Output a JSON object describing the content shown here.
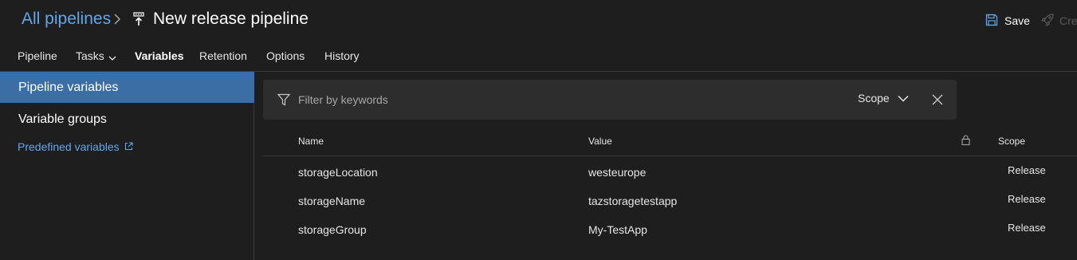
{
  "header": {
    "breadcrumb_root": "All pipelines",
    "title": "New release pipeline",
    "save_label": "Save",
    "create_label": "Cre"
  },
  "tabs": [
    {
      "label": "Pipeline"
    },
    {
      "label": "Tasks"
    },
    {
      "label": "Variables",
      "active": true
    },
    {
      "label": "Retention"
    },
    {
      "label": "Options"
    },
    {
      "label": "History"
    }
  ],
  "sidebar": {
    "items": [
      {
        "label": "Pipeline variables",
        "selected": true
      },
      {
        "label": "Variable groups"
      }
    ],
    "predefined_link": "Predefined variables"
  },
  "filter": {
    "placeholder": "Filter by keywords",
    "value": "",
    "scope_label": "Scope"
  },
  "table": {
    "columns": [
      "Name",
      "Value",
      "Scope"
    ],
    "rows": [
      {
        "name": "storageLocation",
        "value": "westeurope",
        "scope": "Release"
      },
      {
        "name": "storageName",
        "value": "tazstoragetestapp",
        "scope": "Release"
      },
      {
        "name": "storageGroup",
        "value": "My-TestApp",
        "scope": "Release"
      }
    ]
  },
  "icons": {
    "breadcrumb_separator": "chevron-right-icon",
    "pipeline": "release-pipeline-icon",
    "save": "save-icon",
    "create": "rocket-icon",
    "filter": "filter-icon",
    "scope_dropdown": "chevron-down-icon",
    "clear": "close-icon",
    "secret_column": "lock-icon",
    "external_link": "external-link-icon"
  },
  "colors": {
    "background": "#1e1e1e",
    "link": "#62a7ea",
    "selected": "#3a6ea5",
    "tab_underline": "#3b7bc4",
    "filter_bg": "#2d2d2d"
  }
}
